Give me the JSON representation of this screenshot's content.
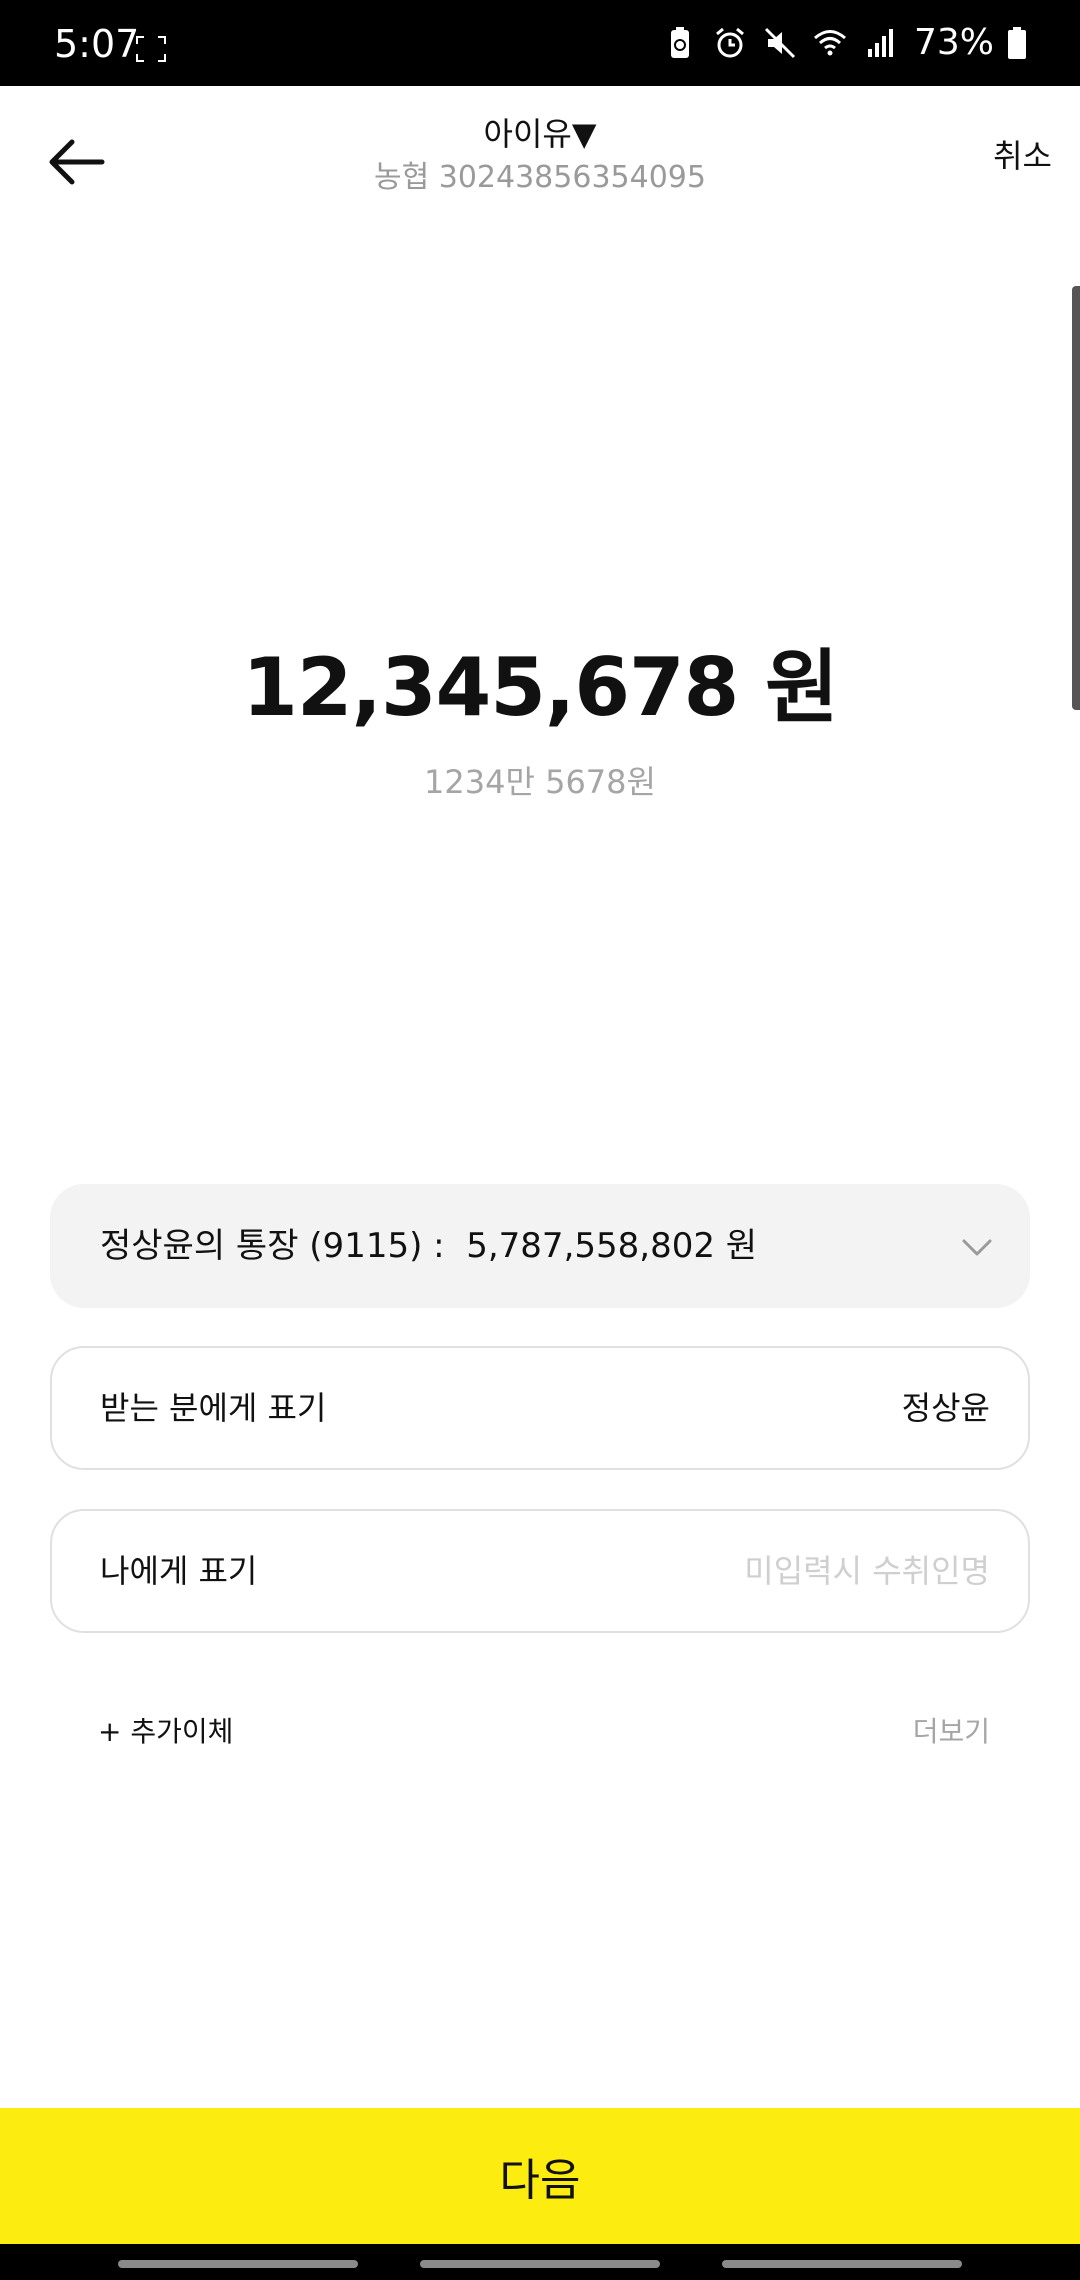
{
  "status_bar": {
    "time": "5:07",
    "battery": "73%",
    "icons": [
      "screenshot-icon",
      "battery-saver-icon",
      "alarm-icon",
      "mute-icon",
      "wifi-icon",
      "signal-icon",
      "battery-icon"
    ]
  },
  "header": {
    "recipient_name": "아이유▼",
    "recipient_account": "농협 30243856354095",
    "cancel_label": "취소"
  },
  "amount": {
    "value": "12,345,678 원",
    "korean": "1234만 5678원"
  },
  "from_account": {
    "label": "정상윤의 통장 (9115) :  5,787,558,802 원"
  },
  "fields": {
    "recipient_display_label": "받는 분에게 표기",
    "recipient_display_value": "정상윤",
    "my_display_label": "나에게 표기",
    "my_display_placeholder": "미입력시 수취인명"
  },
  "links": {
    "extra_transfer": "+ 추가이체",
    "more": "더보기"
  },
  "next_button": "다음",
  "colors": {
    "accent_yellow": "#fcec10",
    "card_gray": "#f3f3f3",
    "muted_text": "#a5a5a5"
  }
}
